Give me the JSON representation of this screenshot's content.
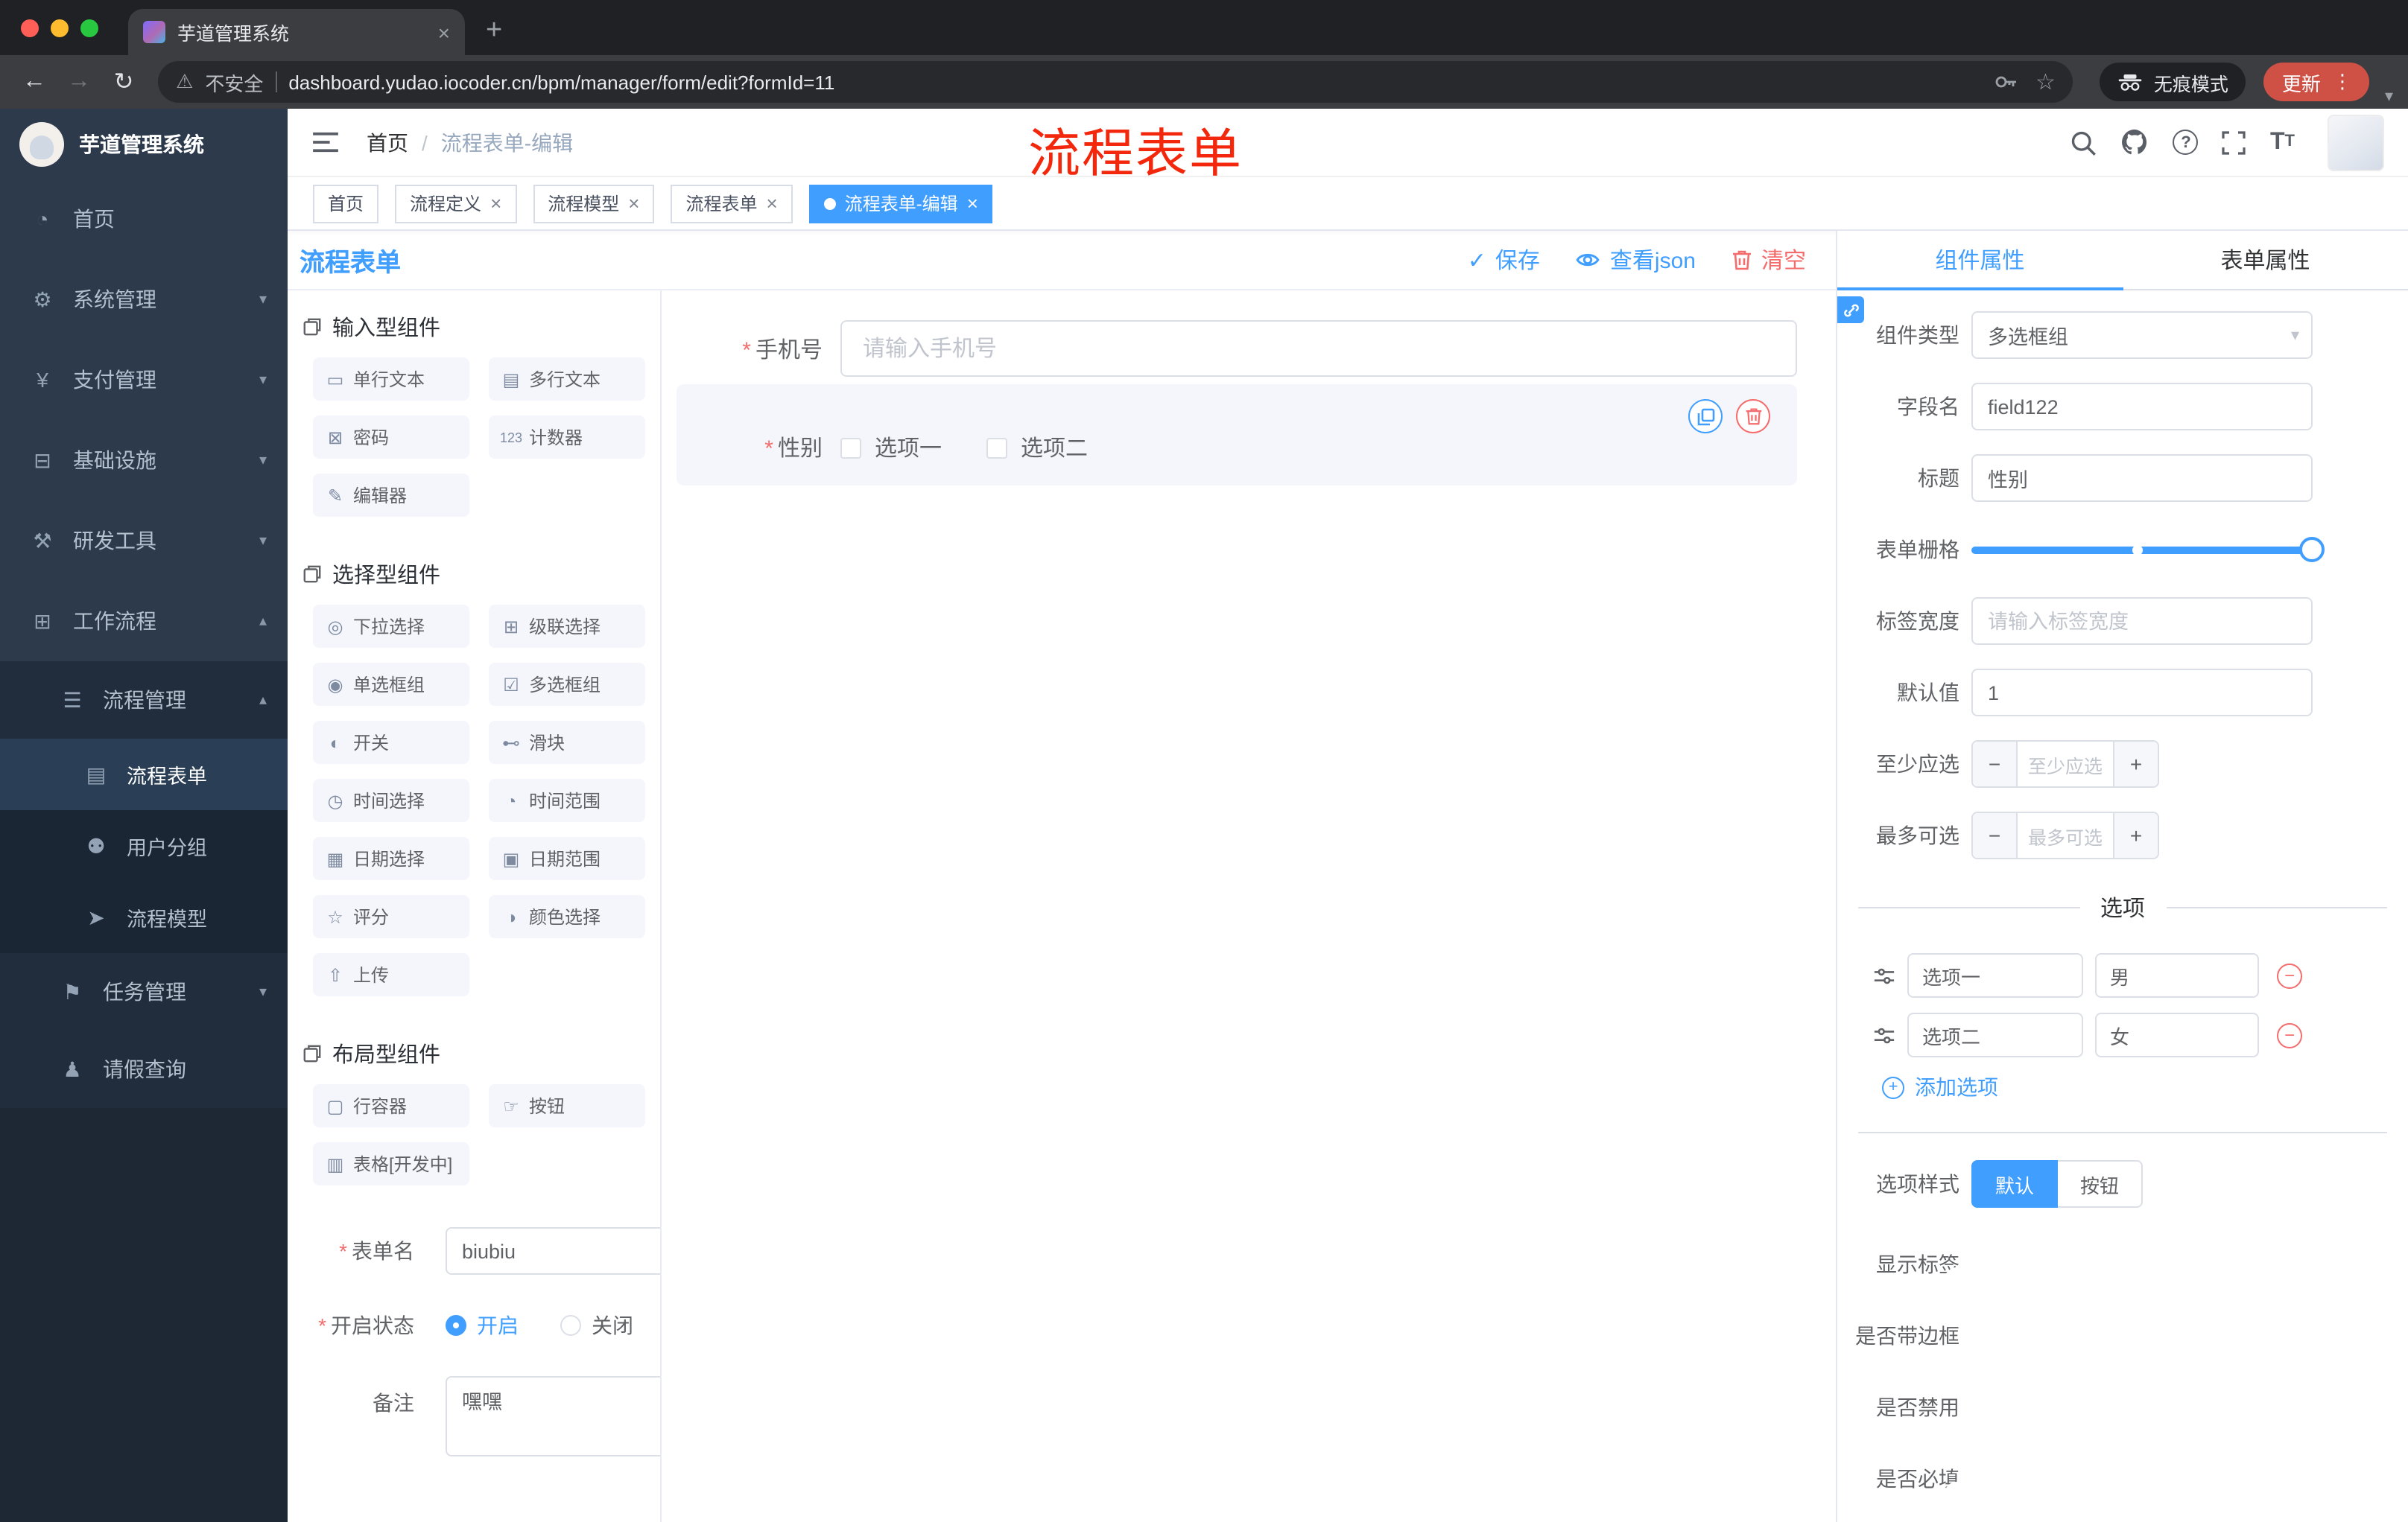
{
  "colors": {
    "accent": "#409eff",
    "danger": "#f56c6c",
    "annotation": "#f2270c"
  },
  "browser": {
    "tab_title": "芋道管理系统",
    "security_label": "不安全",
    "url": "dashboard.yudao.iocoder.cn/bpm/manager/form/edit?formId=11",
    "incognito_label": "无痕模式",
    "update_label": "更新"
  },
  "annotation": "流程表单",
  "sidebar": {
    "logo_title": "芋道管理系统",
    "items": [
      {
        "label": "首页",
        "icon": "dashboard-icon"
      },
      {
        "label": "系统管理",
        "icon": "gear-icon"
      },
      {
        "label": "支付管理",
        "icon": "payment-icon"
      },
      {
        "label": "基础设施",
        "icon": "infrastructure-icon"
      },
      {
        "label": "研发工具",
        "icon": "devtools-icon"
      },
      {
        "label": "工作流程",
        "icon": "workflow-icon"
      },
      {
        "label": "流程管理",
        "icon": "process-management-icon"
      },
      {
        "label": "流程表单",
        "icon": "process-form-icon"
      },
      {
        "label": "用户分组",
        "icon": "user-group-icon"
      },
      {
        "label": "流程模型",
        "icon": "process-model-icon"
      },
      {
        "label": "任务管理",
        "icon": "task-management-icon"
      },
      {
        "label": "请假查询",
        "icon": "leave-query-icon"
      }
    ]
  },
  "header": {
    "breadcrumb": [
      "首页",
      "流程表单-编辑"
    ],
    "separator": "/"
  },
  "tags_view": [
    {
      "label": "首页"
    },
    {
      "label": "流程定义"
    },
    {
      "label": "流程模型"
    },
    {
      "label": "流程表单"
    },
    {
      "label": "流程表单-编辑"
    }
  ],
  "designer": {
    "title": "流程表单",
    "actions": {
      "save": "保存",
      "view_json": "查看json",
      "clear": "清空"
    }
  },
  "palette": {
    "groups": [
      {
        "title": "输入型组件",
        "items": [
          {
            "label": "单行文本",
            "icon": "input-icon"
          },
          {
            "label": "多行文本",
            "icon": "textarea-icon"
          },
          {
            "label": "密码",
            "icon": "password-icon"
          },
          {
            "label": "计数器",
            "icon": "counter-icon"
          },
          {
            "label": "编辑器",
            "icon": "editor-icon"
          }
        ]
      },
      {
        "title": "选择型组件",
        "items": [
          {
            "label": "下拉选择",
            "icon": "select-icon"
          },
          {
            "label": "级联选择",
            "icon": "cascader-icon"
          },
          {
            "label": "单选框组",
            "icon": "radio-icon"
          },
          {
            "label": "多选框组",
            "icon": "checkbox-icon"
          },
          {
            "label": "开关",
            "icon": "switch-icon"
          },
          {
            "label": "滑块",
            "icon": "slider-icon"
          },
          {
            "label": "时间选择",
            "icon": "time-icon"
          },
          {
            "label": "时间范围",
            "icon": "time-range-icon"
          },
          {
            "label": "日期选择",
            "icon": "date-icon"
          },
          {
            "label": "日期范围",
            "icon": "date-range-icon"
          },
          {
            "label": "评分",
            "icon": "rate-icon"
          },
          {
            "label": "颜色选择",
            "icon": "color-icon"
          },
          {
            "label": "上传",
            "icon": "upload-icon"
          }
        ]
      },
      {
        "title": "布局型组件",
        "items": [
          {
            "label": "行容器",
            "icon": "row-icon"
          },
          {
            "label": "按钮",
            "icon": "button-icon"
          },
          {
            "label": "表格[开发中]",
            "icon": "table-icon"
          }
        ]
      }
    ]
  },
  "form_config": {
    "form_name": {
      "label": "表单名",
      "value": "biubiu"
    },
    "status": {
      "label": "开启状态",
      "on": "开启",
      "off": "关闭",
      "selected": "开启"
    },
    "remark": {
      "label": "备注",
      "value": "嘿嘿"
    }
  },
  "canvas": {
    "phone_field": {
      "label": "手机号",
      "placeholder": "请输入手机号"
    },
    "gender_field": {
      "label": "性别",
      "options": [
        "选项一",
        "选项二"
      ]
    }
  },
  "properties": {
    "tabs": {
      "component": "组件属性",
      "form": "表单属性",
      "active": "组件属性"
    },
    "component_type": {
      "label": "组件类型",
      "value": "多选框组"
    },
    "field_name": {
      "label": "字段名",
      "value": "field122"
    },
    "title": {
      "label": "标题",
      "value": "性别"
    },
    "form_grid": {
      "label": "表单栅格"
    },
    "label_width": {
      "label": "标签宽度",
      "placeholder": "请输入标签宽度"
    },
    "default_value": {
      "label": "默认值",
      "value": "1"
    },
    "min_select": {
      "label": "至少应选",
      "placeholder": "至少应选"
    },
    "max_select": {
      "label": "最多可选",
      "placeholder": "最多可选"
    },
    "options_section": {
      "title": "选项",
      "add_label": "添加选项",
      "rows": [
        {
          "label": "选项一",
          "value": "男"
        },
        {
          "label": "选项二",
          "value": "女"
        }
      ]
    },
    "option_style": {
      "label": "选项样式",
      "choices": [
        "默认",
        "按钮"
      ],
      "selected": "默认"
    },
    "switches": [
      {
        "label": "显示标签",
        "on": true
      },
      {
        "label": "是否带边框",
        "on": false
      },
      {
        "label": "是否禁用",
        "on": false
      },
      {
        "label": "是否必填",
        "on": true
      }
    ]
  }
}
